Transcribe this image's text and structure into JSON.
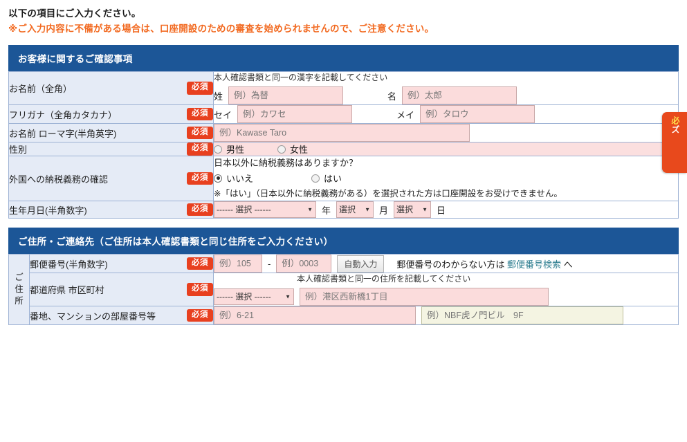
{
  "intro": {
    "line1": "以下の項目にご入力ください。",
    "line2": "※ご入力内容に不備がある場合は、口座開設のための審査を始められませんので、ご注意ください。"
  },
  "side_tab": {
    "text": "必ズ"
  },
  "common": {
    "required_badge": "必須"
  },
  "section1": {
    "header": "お客様に関するご確認事項",
    "rows": {
      "name": {
        "label": "お名前（全角）",
        "hint": "本人確認書類と同一の漢字を記載してください",
        "sei_label": "姓",
        "sei_placeholder": "例）為替",
        "mei_label": "名",
        "mei_placeholder": "例）太郎"
      },
      "furigana": {
        "label": "フリガナ（全角カタカナ）",
        "sei_label": "セイ",
        "sei_placeholder": "例）カワセ",
        "mei_label": "メイ",
        "mei_placeholder": "例）タロウ"
      },
      "romaji": {
        "label": "お名前 ローマ字(半角英字)",
        "placeholder": "例）Kawase Taro"
      },
      "gender": {
        "label": "性別",
        "option_male": "男性",
        "option_female": "女性"
      },
      "tax": {
        "label": "外国への納税義務の確認",
        "question": "日本以外に納税義務はありますか？",
        "option_no": "いいえ",
        "option_yes": "はい",
        "note": "※「はい」（日本以外に納税義務がある）を選択された方は口座開設をお受けできません。"
      },
      "birth": {
        "label": "生年月日(半角数字)",
        "year_value": "------ 選択 ------",
        "year_unit": "年",
        "month_value": "選択",
        "month_unit": "月",
        "day_value": "選択",
        "day_unit": "日"
      }
    }
  },
  "section2": {
    "header": "ご住所・ご連絡先（ご住所は本人確認書類と同じ住所をご入力ください）",
    "vertical_label": [
      "ご",
      "住",
      "所"
    ],
    "rows": {
      "zip": {
        "label": "郵便番号(半角数字)",
        "zip1_placeholder": "例）105",
        "separator": "-",
        "zip2_placeholder": "例）0003",
        "auto_button": "自動入力",
        "after_text_pre": "郵便番号のわからない方は ",
        "link_text": "郵便番号検索",
        "after_text_post": " へ"
      },
      "pref": {
        "label": "都道府県 市区町村",
        "hint": "本人確認書類と同一の住所を記載してください",
        "select_value": "------ 選択 ------",
        "city_placeholder": "例）港区西新橋1丁目"
      },
      "addr": {
        "label": "番地、マンションの部屋番号等",
        "addr1_placeholder": "例）6-21",
        "addr2_placeholder": "例）NBF虎ノ門ビル　9F"
      }
    }
  }
}
